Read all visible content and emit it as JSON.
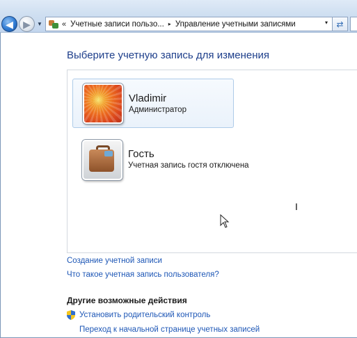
{
  "toolbar": {
    "back_icon": "back-arrow-icon",
    "forward_icon": "forward-arrow-icon",
    "history_icon": "chevron-down-icon",
    "address": {
      "icon": "user-accounts-icon",
      "overflow": "«",
      "breadcrumbs": [
        {
          "label": "Учетные записи пользо..."
        },
        {
          "label": "Управление учетными записями"
        }
      ],
      "separator": "▸",
      "dropdown": "▾"
    },
    "refresh_icon": "refresh-icon"
  },
  "main": {
    "title": "Выберите учетную запись для изменения",
    "accounts": [
      {
        "name": "Vladimir",
        "role": "Администратор",
        "avatar": "flower-avatar",
        "selected": true
      },
      {
        "name": "Гость",
        "role": "Учетная запись гостя отключена",
        "avatar": "briefcase-avatar",
        "selected": false
      }
    ],
    "links": {
      "create": "Создание учетной записи",
      "what_is": "Что такое учетная запись пользователя?"
    },
    "other_actions": {
      "heading": "Другие возможные действия",
      "parental": "Установить родительский контроль",
      "home": "Переход к начальной странице учетных записей"
    }
  },
  "colors": {
    "title": "#1e3f8b",
    "link": "#1e57b6",
    "selected_border": "#aecbe8"
  }
}
